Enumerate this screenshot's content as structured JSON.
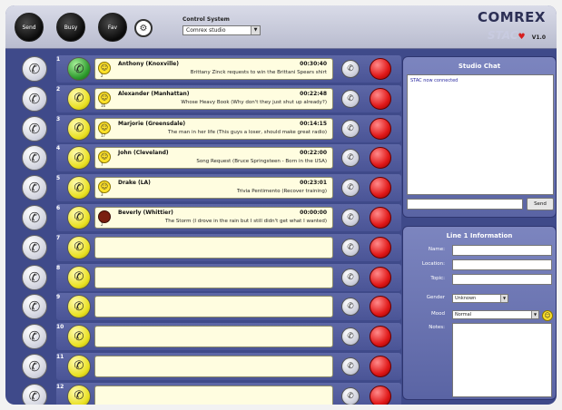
{
  "topbar": {
    "buttons": [
      "Send",
      "Busy",
      "Fav"
    ],
    "control_system_label": "Control System",
    "studio_select": "Comrex studio"
  },
  "logo": {
    "brand": "COMREX",
    "product": "STAC",
    "version": "V1.0"
  },
  "calls": [
    {
      "num": "1",
      "state": "green",
      "mood": "happy",
      "mood_count": "2",
      "caller": "Anthony (Knoxville)",
      "time": "00:30:40",
      "topic": "Brittany Zinck requests to win the Brittani Spears shirt"
    },
    {
      "num": "2",
      "state": "yellow",
      "mood": "happy",
      "mood_count": "16",
      "caller": "Alexander (Manhattan)",
      "time": "00:22:48",
      "topic": "Whose Heavy Book (Why don't they just shut up already?)"
    },
    {
      "num": "3",
      "state": "yellow",
      "mood": "happy",
      "mood_count": "17",
      "caller": "Marjorie (Greensdale)",
      "time": "00:14:15",
      "topic": "The man in her life (This guys a loser, should make great radio)"
    },
    {
      "num": "4",
      "state": "yellow",
      "mood": "happy",
      "mood_count": "7",
      "caller": "John (Cleveland)",
      "time": "00:22:00",
      "topic": "Song Request (Bruce Springsteen - Born in the USA)"
    },
    {
      "num": "5",
      "state": "yellow",
      "mood": "happy",
      "mood_count": "3",
      "caller": "Drake (LA)",
      "time": "00:23:01",
      "topic": "Trivia Pentimento (Recover training)"
    },
    {
      "num": "6",
      "state": "yellow",
      "mood": "dark",
      "mood_count": "2",
      "caller": "Beverly (Whittier)",
      "time": "00:00:00",
      "topic": "The Storm (I drove in the rain but I still didn't get what I wanted)"
    },
    {
      "num": "7",
      "state": "yellow"
    },
    {
      "num": "8",
      "state": "yellow"
    },
    {
      "num": "9",
      "state": "yellow"
    },
    {
      "num": "10",
      "state": "yellow"
    },
    {
      "num": "11",
      "state": "yellow"
    },
    {
      "num": "12",
      "state": "yellow"
    }
  ],
  "chat": {
    "title": "Studio Chat",
    "message": "STAC now connected",
    "send_label": "Send"
  },
  "info": {
    "title": "Line 1 Information",
    "name_label": "Name:",
    "location_label": "Location:",
    "topic_label": "Topic:",
    "gender_label": "Gender",
    "gender_value": "Unknown",
    "mood_label": "Mood",
    "mood_value": "Normal",
    "notes_label": "Notes:"
  },
  "colors": {
    "frame": "#3f4a8a",
    "card": "#fffde0",
    "line_yellow": "#e9e021",
    "line_green": "#2d9a2d",
    "drop_red": "#e01818"
  }
}
